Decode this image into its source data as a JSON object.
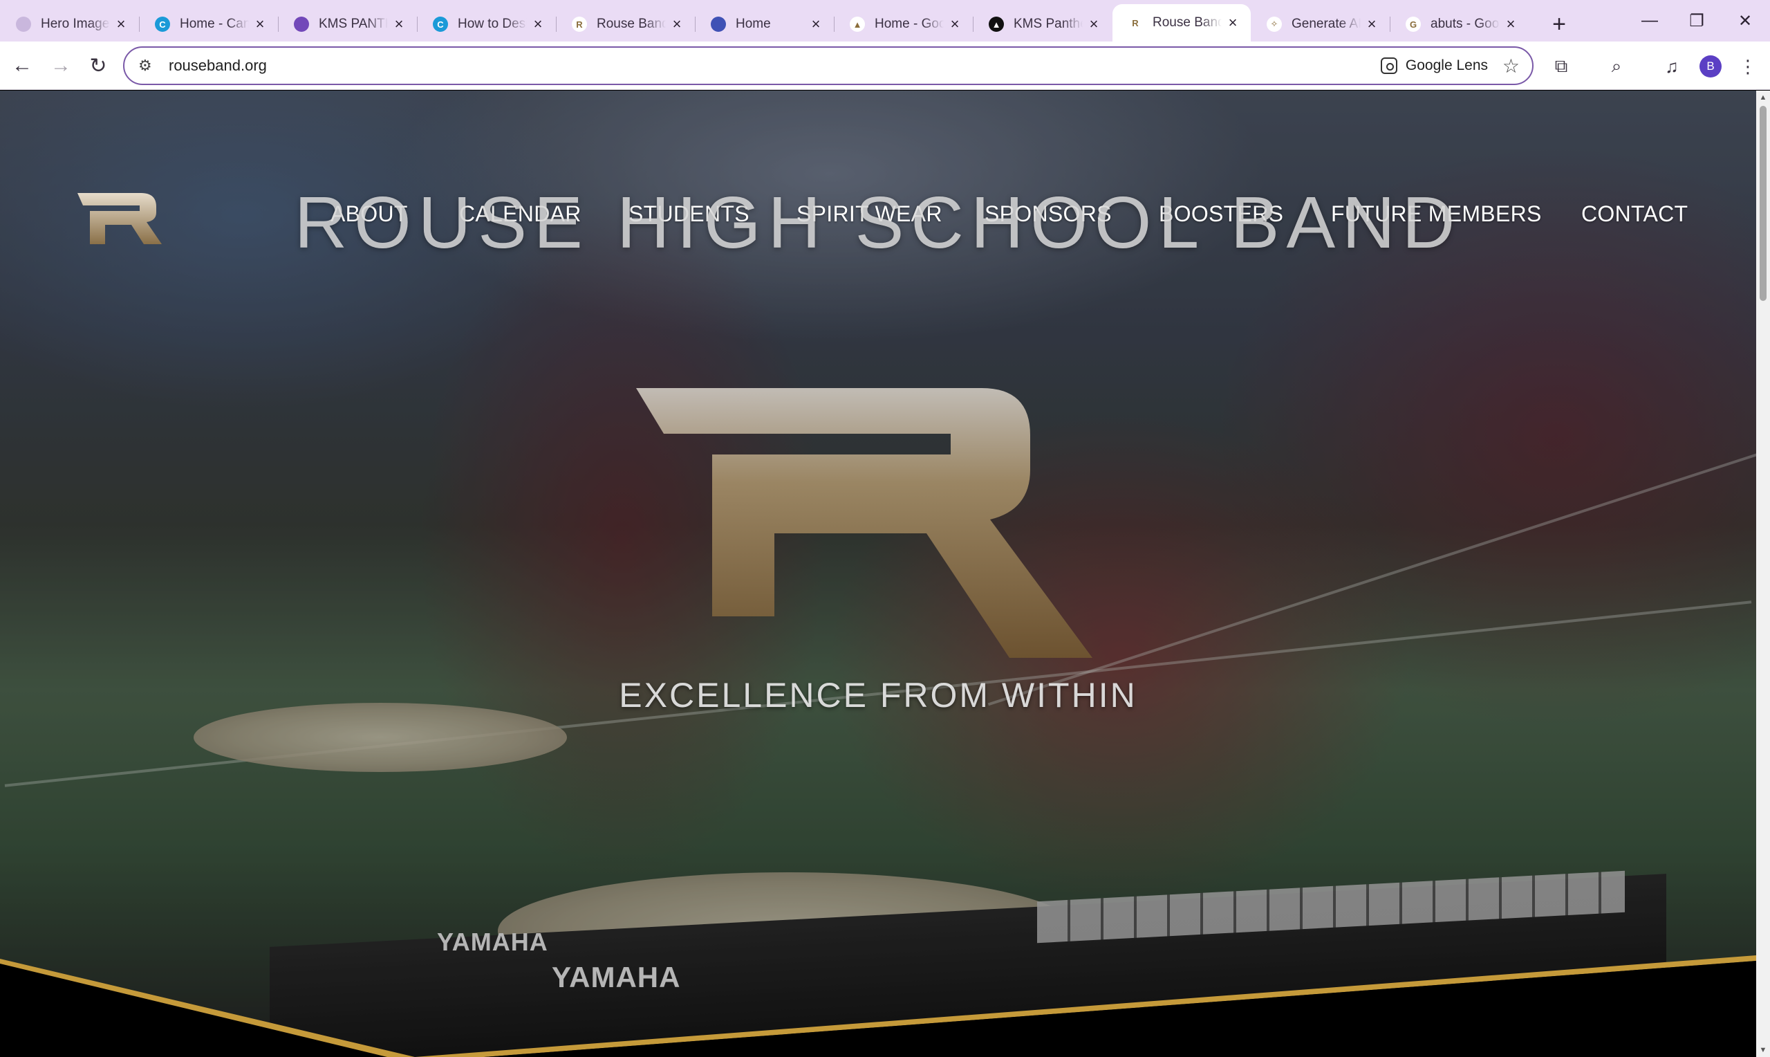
{
  "browser": {
    "tabs": [
      {
        "title": "Hero Image",
        "favicon": "hero-favicon",
        "fav_color": "#c9b7dd",
        "fav_glyph": ""
      },
      {
        "title": "Home - Canva",
        "favicon": "canva-favicon",
        "fav_color": "#1b9ad8",
        "fav_glyph": "C"
      },
      {
        "title": "KMS PANTHERS",
        "favicon": "forms-favicon",
        "fav_color": "#7248b9",
        "fav_glyph": ""
      },
      {
        "title": "How to Design",
        "favicon": "canva-favicon",
        "fav_color": "#1b9ad8",
        "fav_glyph": "C"
      },
      {
        "title": "Rouse Band",
        "favicon": "rouse-favicon",
        "fav_color": "#ffffff",
        "fav_glyph": "R"
      },
      {
        "title": "Home",
        "favicon": "sites-favicon",
        "fav_color": "#3f51b5",
        "fav_glyph": ""
      },
      {
        "title": "Home - Google Drive",
        "favicon": "drive-favicon",
        "fav_color": "#ffffff",
        "fav_glyph": "▲"
      },
      {
        "title": "KMS Panthers",
        "favicon": "panther-favicon",
        "fav_color": "#111111",
        "fav_glyph": "▲"
      },
      {
        "title": "Rouse Band",
        "favicon": "rouse-favicon",
        "fav_color": "#ffffff",
        "fav_glyph": "R",
        "active": true
      },
      {
        "title": "Generate AI",
        "favicon": "ai-favicon",
        "fav_color": "#ffffff",
        "fav_glyph": "✧"
      },
      {
        "title": "abuts - Google",
        "favicon": "google-favicon",
        "fav_color": "#ffffff",
        "fav_glyph": "G"
      }
    ],
    "url": "rouseband.org",
    "lens_label": "Google Lens",
    "profile_initial": "B",
    "accent": "#7a59a8"
  },
  "site": {
    "nav": [
      "ABOUT",
      "CALENDAR",
      "STUDENTS",
      "SPIRIT WEAR",
      "SPONSORS",
      "BOOSTERS",
      "FUTURE MEMBERS",
      "CONTACT"
    ],
    "hero_title": "ROUSE HIGH SCHOOL BAND",
    "tagline": "EXCELLENCE FROM WITHIN",
    "photo_brand_1": "YAMAHA",
    "photo_brand_2": "YAMAHA",
    "colors": {
      "gold": "#b9a178",
      "gold_dark": "#6b5531",
      "maroon": "#7d1b2b",
      "accent_band": "#c59a3a"
    }
  }
}
